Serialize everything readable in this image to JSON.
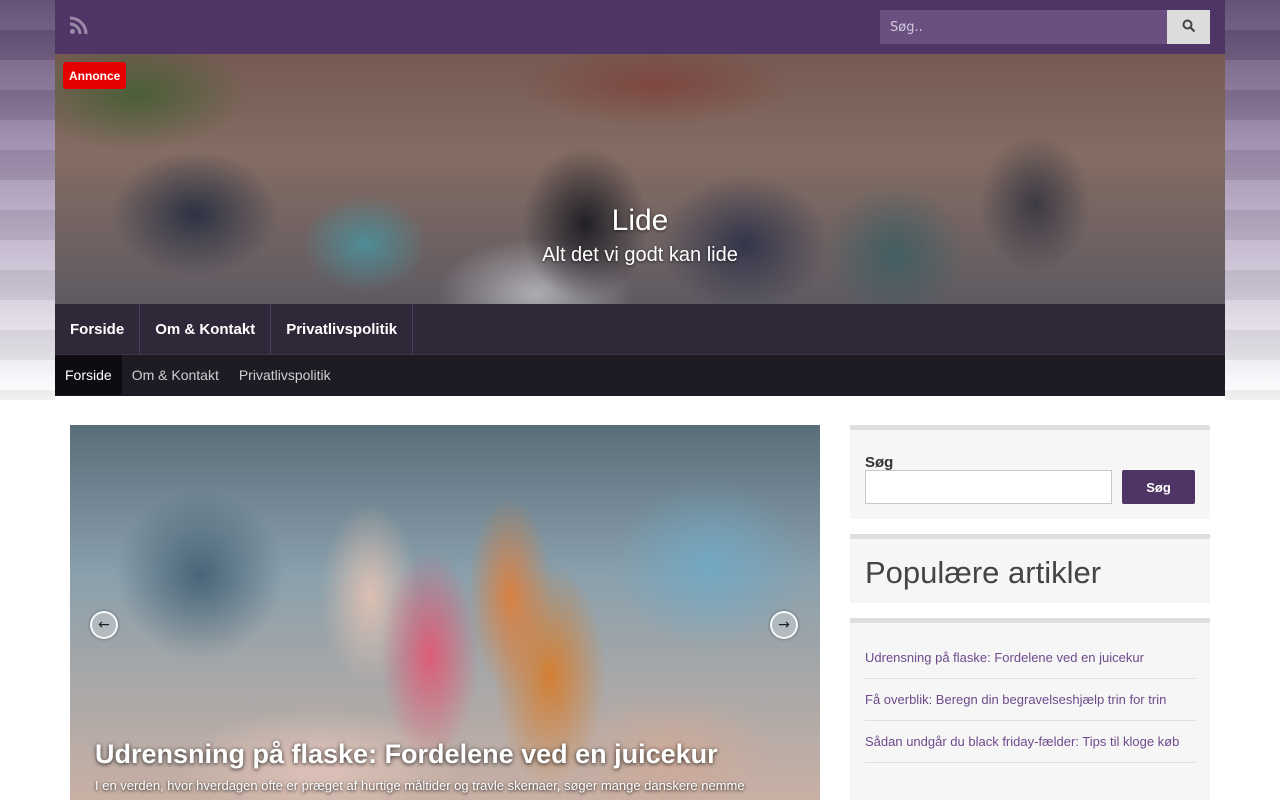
{
  "topbar": {
    "rss_icon": "rss-icon",
    "search_placeholder": "Søg..",
    "search_icon": "search-icon"
  },
  "hero": {
    "badge": "Annonce",
    "site_title": "Lide",
    "tagline": "Alt det vi godt kan lide"
  },
  "main_nav": {
    "items": [
      {
        "label": "Forside"
      },
      {
        "label": "Om & Kontakt"
      },
      {
        "label": "Privatlivspolitik"
      }
    ]
  },
  "sub_nav": {
    "items": [
      {
        "label": "Forside",
        "active": true
      },
      {
        "label": "Om & Kontakt",
        "active": false
      },
      {
        "label": "Privatlivspolitik",
        "active": false
      }
    ]
  },
  "slider": {
    "prev_icon": "arrow-left-icon",
    "next_icon": "arrow-right-icon",
    "title": "Udrensning på flaske: Fordelene ved en juicekur",
    "excerpt": "I en verden, hvor hverdagen ofte er præget af hurtige måltider og travle skemaer, søger mange danskere nemme"
  },
  "sidebar": {
    "search": {
      "label": "Søg",
      "button": "Søg"
    },
    "popular": {
      "heading": "Populære artikler",
      "items": [
        "Udrensning på flaske: Fordelene ved en juicekur",
        "Få overblik: Beregn din begravelseshjælp trin for trin",
        "Sådan undgår du black friday-fælder: Tips til kloge køb"
      ]
    }
  },
  "colors": {
    "brand_purple": "#4f3566",
    "nav_dark": "#2e2838",
    "link_purple": "#6e4a8c",
    "ad_red": "#e60000"
  }
}
